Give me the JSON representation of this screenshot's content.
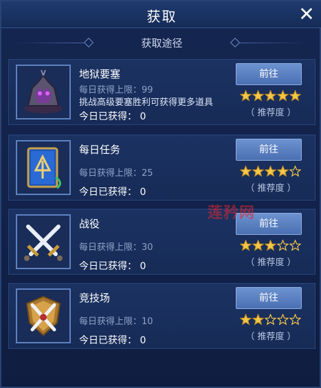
{
  "window": {
    "title": "获取",
    "close_icon": "close-icon",
    "subtitle": "获取途径"
  },
  "colors": {
    "accent": "#5a7fc0",
    "star": "#f5c84a",
    "background": "#13244c"
  },
  "sources": [
    {
      "name": "地狱要塞",
      "icon": "fortress-icon",
      "limit_label": "每日获得上限：99",
      "description": "挑战高级要塞胜利可获得更多道具",
      "today_label": "今日已获得：  0",
      "button": "前往",
      "stars": 5,
      "rec_label": "（ 推荐度 ）"
    },
    {
      "name": "每日任务",
      "icon": "quest-book-icon",
      "limit_label": "每日获得上限：25",
      "description": "",
      "today_label": "今日已获得：  0",
      "button": "前往",
      "stars": 4,
      "rec_label": "（ 推荐度 ）"
    },
    {
      "name": "战役",
      "icon": "crossed-swords-icon",
      "limit_label": "每日获得上限：30",
      "description": "",
      "today_label": "今日已获得：  0",
      "button": "前往",
      "stars": 3,
      "rec_label": "（ 推荐度 ）"
    },
    {
      "name": "竞技场",
      "icon": "arena-shield-icon",
      "limit_label": "每日获得上限：10",
      "description": "",
      "today_label": "今日已获得：  0",
      "button": "前往",
      "stars": 2,
      "rec_label": "（ 推荐度 ）"
    }
  ],
  "star_max": 5,
  "watermark": "莲矜网"
}
